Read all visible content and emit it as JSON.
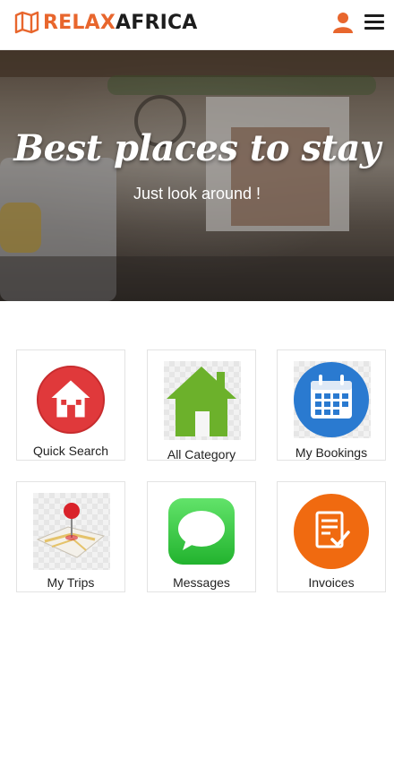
{
  "header": {
    "logo_relax": "RELAX",
    "logo_africa": "AFRICA",
    "logo_icon": "map-icon",
    "user_icon": "user-icon",
    "menu_icon": "hamburger-menu-icon"
  },
  "hero": {
    "title": "Best places to stay",
    "subtitle": "Just look around !"
  },
  "tiles": [
    {
      "label": "Quick Search",
      "icon": "house-icon"
    },
    {
      "label": "All Category",
      "icon": "home-icon"
    },
    {
      "label": "My Bookings",
      "icon": "calendar-icon"
    },
    {
      "label": "My Trips",
      "icon": "map-pin-icon"
    },
    {
      "label": "Messages",
      "icon": "chat-bubble-icon"
    },
    {
      "label": "Invoices",
      "icon": "invoice-icon"
    }
  ],
  "colors": {
    "brand": "#e8662d",
    "dark": "#1d1d1d",
    "quick_search_red": "#e0393b",
    "category_green": "#6cb12b",
    "bookings_blue": "#2a7ad0",
    "messages_green": "#3fcf4a",
    "invoices_orange": "#f06a10"
  }
}
